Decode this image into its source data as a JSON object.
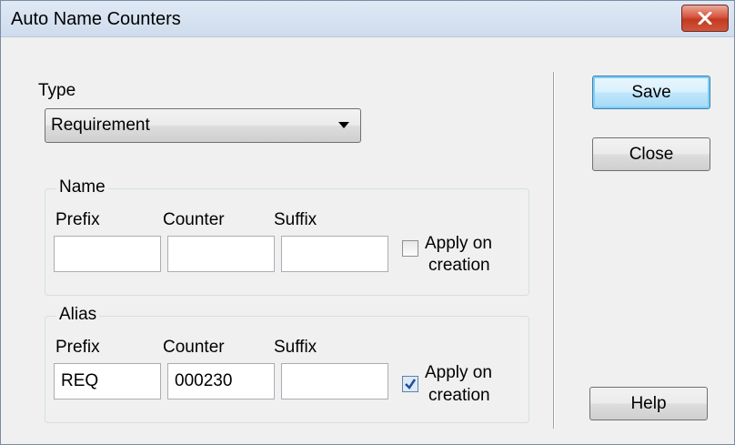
{
  "window": {
    "title": "Auto Name Counters"
  },
  "type_section": {
    "label": "Type",
    "selected": "Requirement"
  },
  "name_group": {
    "legend": "Name",
    "prefix_label": "Prefix",
    "counter_label": "Counter",
    "suffix_label": "Suffix",
    "prefix_value": "",
    "counter_value": "",
    "suffix_value": "",
    "apply_label_line1": "Apply on",
    "apply_label_line2": "creation",
    "apply_checked": false
  },
  "alias_group": {
    "legend": "Alias",
    "prefix_label": "Prefix",
    "counter_label": "Counter",
    "suffix_label": "Suffix",
    "prefix_value": "REQ",
    "counter_value": "000230",
    "suffix_value": "",
    "apply_label_line1": "Apply on",
    "apply_label_line2": "creation",
    "apply_checked": true
  },
  "buttons": {
    "save": "Save",
    "close": "Close",
    "help": "Help"
  },
  "icons": {
    "window_close": "close-icon",
    "dropdown": "chevron-down-icon",
    "check": "checkmark-icon"
  },
  "colors": {
    "close_button": "#c23a22",
    "default_button_border": "#3c7fb1",
    "check_mark": "#1f4e9b"
  }
}
